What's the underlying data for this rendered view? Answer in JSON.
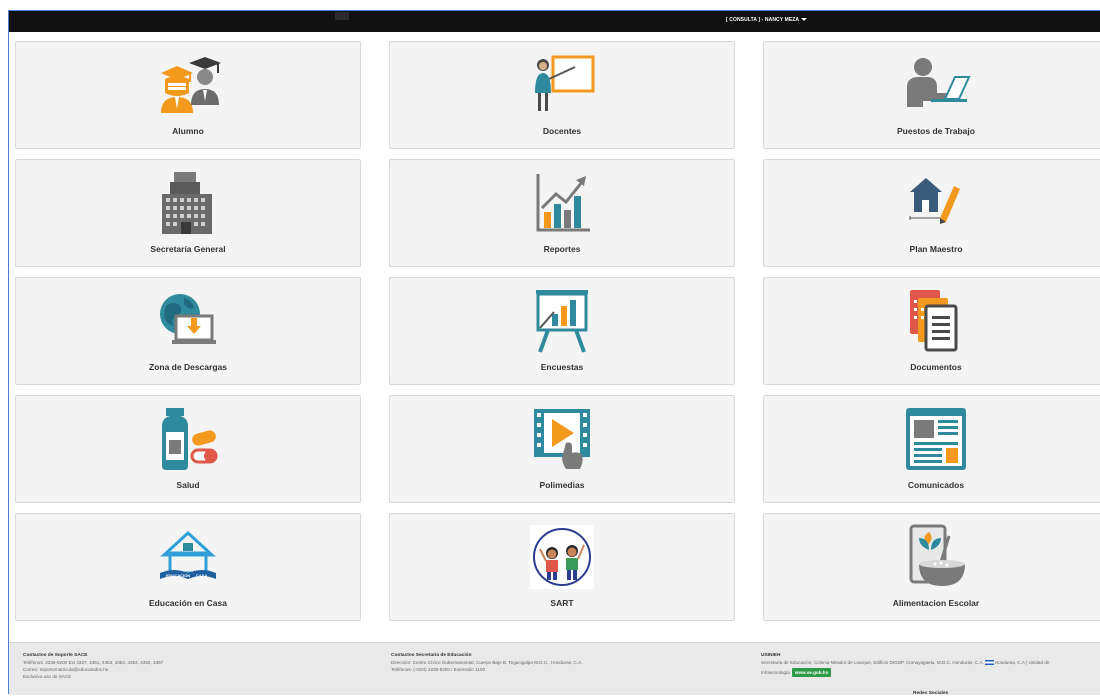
{
  "header": {
    "user_menu": "[ CONSULTA ] - NANCY MEZA"
  },
  "colors": {
    "accent_orange": "#f39a1e",
    "icon_teal": "#2f8a9e",
    "icon_gray": "#7a7a7a",
    "dark_bar": "#111111"
  },
  "tiles": [
    {
      "label": "Alumno",
      "icon": "graduates-icon"
    },
    {
      "label": "Docentes",
      "icon": "teacher-board-icon"
    },
    {
      "label": "Puestos de Trabajo",
      "icon": "workstation-icon"
    },
    {
      "label": "Secretaría General",
      "icon": "building-icon"
    },
    {
      "label": "Reportes",
      "icon": "growth-chart-icon"
    },
    {
      "label": "Plan Maestro",
      "icon": "house-plan-icon"
    },
    {
      "label": "Zona de Descargas",
      "icon": "globe-download-icon"
    },
    {
      "label": "Encuestas",
      "icon": "presentation-easel-icon"
    },
    {
      "label": "Documentos",
      "icon": "documents-icon"
    },
    {
      "label": "Salud",
      "icon": "medicine-icon"
    },
    {
      "label": "Polimedias",
      "icon": "video-play-icon"
    },
    {
      "label": "Comunicados",
      "icon": "newspaper-icon"
    },
    {
      "label": "Educación en Casa",
      "icon": "home-education-icon"
    },
    {
      "label": "SART",
      "icon": "sart-logo-icon"
    },
    {
      "label": "Alimentacion Escolar",
      "icon": "school-food-icon"
    }
  ],
  "footer": {
    "sace": {
      "title": "Contactos de Soporte SACE",
      "phone": "Teléfonos: 2236-8200 Ext 4327, 4351, 4353, 4362, 4364, 4350, 4357",
      "email": "Correo: soportematricula@educatodos.hn",
      "note": "Exclusivo uso de SACE"
    },
    "secretaria": {
      "title": "Contactos Secretaría de Educación",
      "address": "Dirección: Centro Cívico Gubernamental, Cuerpo Bajo B, Tegucigalpa M.D.C., Honduras, C.A.",
      "phone": "Teléfonos: (+504) 2236-8200 / Extensión 1100"
    },
    "usinieh": {
      "title": "USINIEH",
      "line1": "Secretaría de Educación, Colonia Mirador de Loarque, Edificio DIGDP, Comayagüela, M.D.C. Honduras, C.A.",
      "line1b": "Honduras, C.A | Unidad de",
      "line2": "Infotecnología",
      "badge": "www.se.gob.hn"
    },
    "social_title": "Redes Sociales"
  }
}
